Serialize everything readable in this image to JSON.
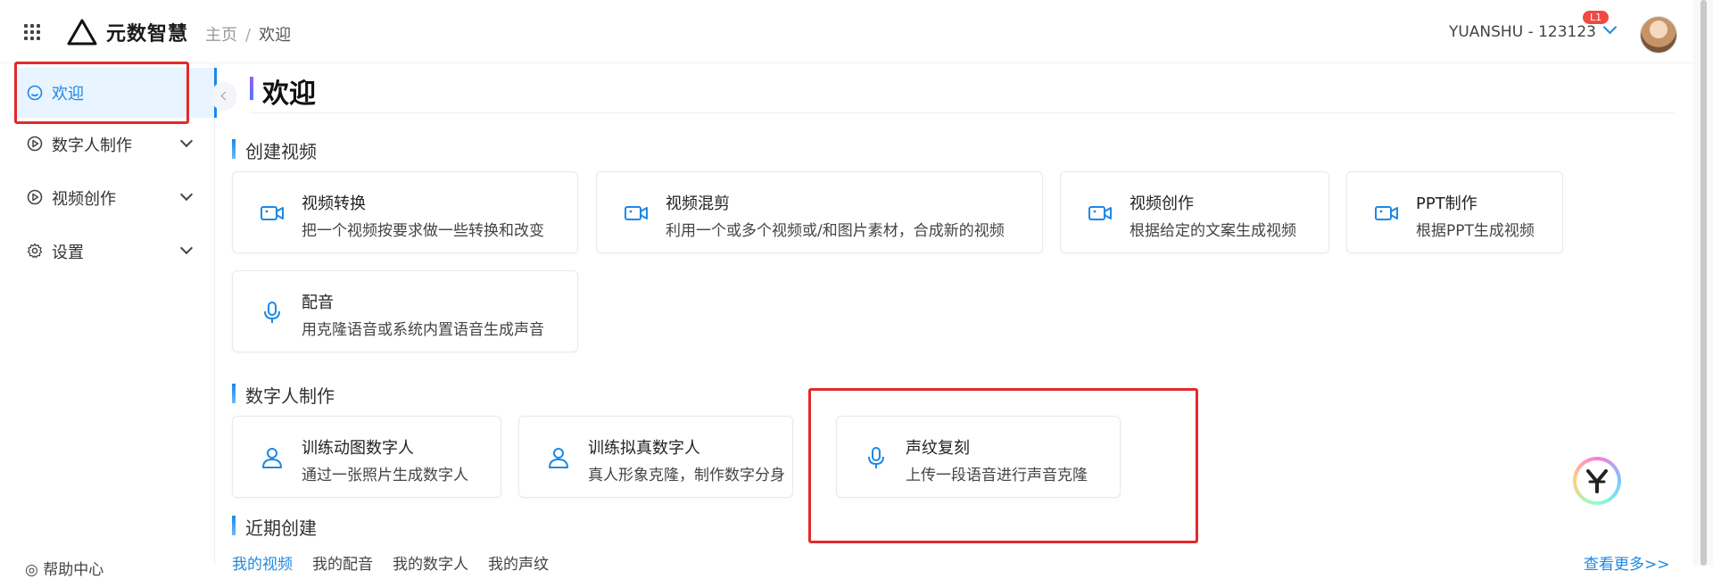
{
  "header": {
    "brand": "元数智慧",
    "breadcrumb": {
      "home": "主页",
      "separator": "/",
      "current": "欢迎"
    },
    "user": "YUANSHU - 123123",
    "level_badge": "L1"
  },
  "sidebar": {
    "items": [
      {
        "label": "欢迎",
        "icon": "smile-icon",
        "active": true
      },
      {
        "label": "数字人制作",
        "icon": "play-circle-icon"
      },
      {
        "label": "视频创作",
        "icon": "play-circle-icon"
      },
      {
        "label": "设置",
        "icon": "gear-icon"
      }
    ],
    "help": "帮助中心"
  },
  "main": {
    "title": "欢迎",
    "sections": [
      {
        "title": "创建视频",
        "cards": [
          {
            "title": "视频转换",
            "desc": "把一个视频按要求做一些转换和改变",
            "icon": "video-camera-icon"
          },
          {
            "title": "视频混剪",
            "desc": "利用一个或多个视频或/和图片素材，合成新的视频",
            "icon": "video-camera-icon"
          },
          {
            "title": "视频创作",
            "desc": "根据给定的文案生成视频",
            "icon": "video-camera-icon"
          },
          {
            "title": "PPT制作",
            "desc": "根据PPT生成视频",
            "icon": "video-camera-icon"
          },
          {
            "title": "配音",
            "desc": "用克隆语音或系统内置语音生成声音",
            "icon": "microphone-icon"
          }
        ]
      },
      {
        "title": "数字人制作",
        "cards": [
          {
            "title": "训练动图数字人",
            "desc": "通过一张照片生成数字人",
            "icon": "user-icon"
          },
          {
            "title": "训练拟真数字人",
            "desc": "真人形象克隆，制作数字分身",
            "icon": "user-icon"
          },
          {
            "title": "声纹复刻",
            "desc": "上传一段语音进行声音克隆",
            "icon": "microphone-icon"
          }
        ]
      },
      {
        "title": "近期创建",
        "tabs": [
          "我的视频",
          "我的配音",
          "我的数字人",
          "我的声纹"
        ],
        "more": "查看更多>>"
      }
    ]
  },
  "colors": {
    "accent": "#1e88e5",
    "highlight": "#e02b2b"
  }
}
